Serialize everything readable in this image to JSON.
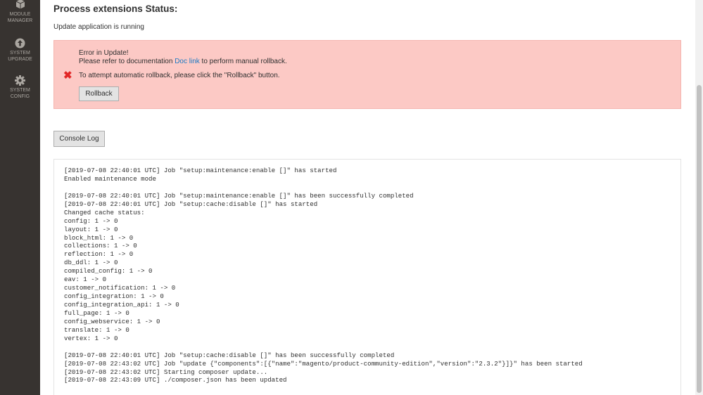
{
  "sidebar": {
    "items": [
      {
        "label_line1": "MODULE",
        "label_line2": "MANAGER",
        "icon": "cube-icon"
      },
      {
        "label_line1": "SYSTEM",
        "label_line2": "UPGRADE",
        "icon": "upload-arrow-icon"
      },
      {
        "label_line1": "SYSTEM",
        "label_line2": "CONFIG",
        "icon": "gear-icon"
      }
    ]
  },
  "header": {
    "title": "Process extensions Status:",
    "status": "Update application is running"
  },
  "error": {
    "title": "Error in Update!",
    "doc_prefix": "Please refer to documentation ",
    "doc_link": "Doc link",
    "doc_suffix": " to perform manual rollback.",
    "auto_rollback": "To attempt automatic rollback, please click the \"Rollback\" button.",
    "rollback_label": "Rollback",
    "icon": "error-x-icon",
    "color": "#e22626",
    "background": "#fcc9c5"
  },
  "console": {
    "button_label": "Console Log",
    "lines": [
      "[2019-07-08 22:40:01 UTC] Job \"setup:maintenance:enable []\" has started",
      "Enabled maintenance mode",
      "",
      "[2019-07-08 22:40:01 UTC] Job \"setup:maintenance:enable []\" has been successfully completed",
      "[2019-07-08 22:40:01 UTC] Job \"setup:cache:disable []\" has started",
      "Changed cache status:",
      "config: 1 -> 0",
      "layout: 1 -> 0",
      "block_html: 1 -> 0",
      "collections: 1 -> 0",
      "reflection: 1 -> 0",
      "db_ddl: 1 -> 0",
      "compiled_config: 1 -> 0",
      "eav: 1 -> 0",
      "customer_notification: 1 -> 0",
      "config_integration: 1 -> 0",
      "config_integration_api: 1 -> 0",
      "full_page: 1 -> 0",
      "config_webservice: 1 -> 0",
      "translate: 1 -> 0",
      "vertex: 1 -> 0",
      "",
      "[2019-07-08 22:40:01 UTC] Job \"setup:cache:disable []\" has been successfully completed",
      "[2019-07-08 22:43:02 UTC] Job \"update {\"components\":[{\"name\":\"magento/product-community-edition\",\"version\":\"2.3.2\"}]}\" has been started",
      "[2019-07-08 22:43:02 UTC] Starting composer update...",
      "[2019-07-08 22:43:09 UTC] ./composer.json has been updated"
    ]
  }
}
